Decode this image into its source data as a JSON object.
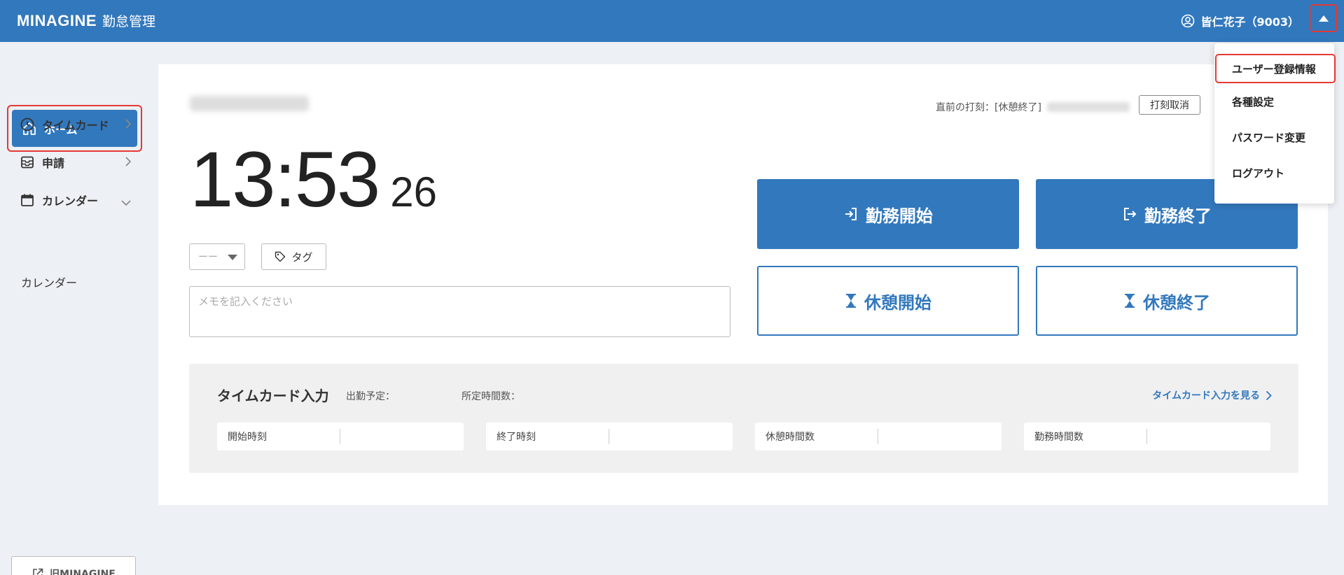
{
  "header": {
    "logo": "MINAGINE",
    "subtitle": "勤怠管理",
    "user": "皆仁花子（9003）"
  },
  "sidebar": {
    "home": "ホーム",
    "timecard": "タイムカード",
    "request": "申請",
    "calendar": "カレンダー",
    "calendar_sub": "カレンダー",
    "old_link": "旧MINAGINE"
  },
  "main": {
    "last_punch_label": "直前の打刻：[休憩終了]",
    "cancel_punch": "打刻取消",
    "clock_hm": "13:53",
    "clock_sec": "26",
    "select_value": "ーー",
    "tag_label": "タグ",
    "memo_placeholder": "メモを記入ください",
    "btn_start_work": "勤務開始",
    "btn_end_work": "勤務終了",
    "btn_start_break": "休憩開始",
    "btn_end_break": "休憩終了"
  },
  "timecard_input": {
    "title": "タイムカード入力",
    "scheduled_label": "出勤予定：",
    "hours_label": "所定時間数：",
    "view_link": "タイムカード入力を見る",
    "fields": [
      "開始時刻",
      "終了時刻",
      "休憩時間数",
      "勤務時間数"
    ]
  },
  "dropdown_menu": {
    "items": [
      "ユーザー登録情報",
      "各種設定",
      "パスワード変更",
      "ログアウト"
    ]
  },
  "colors": {
    "primary": "#3278bd",
    "highlight": "#e53935",
    "background": "#edf0f4"
  }
}
